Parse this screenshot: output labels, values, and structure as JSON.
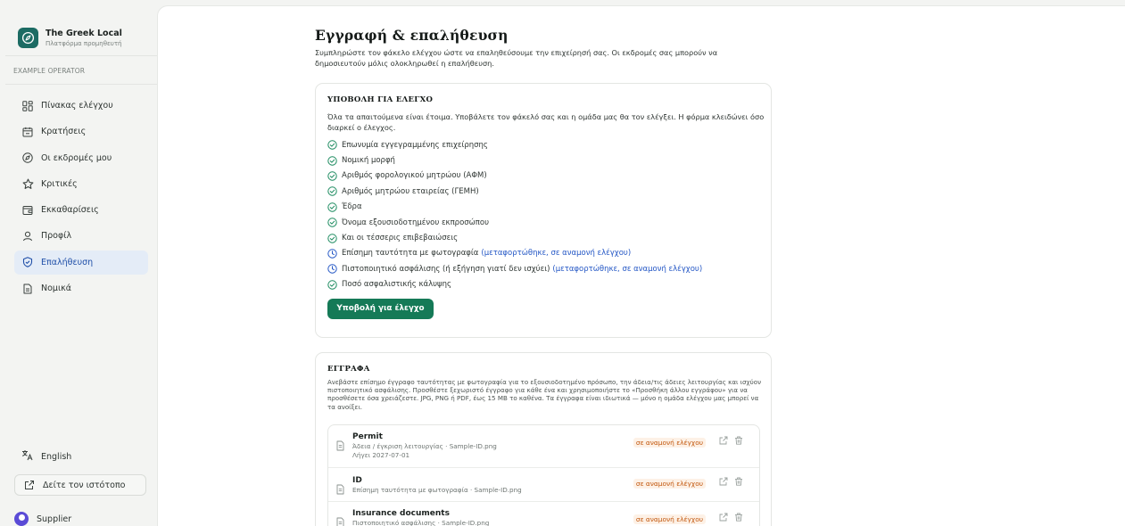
{
  "brand": {
    "name": "The Greek Local",
    "subtitle": "Πλατφόρμα προμηθευτή"
  },
  "operator_label": "EXAMPLE OPERATOR",
  "nav": [
    {
      "label": "Πίνακας ελέγχου",
      "icon": "dashboard-icon",
      "active": false
    },
    {
      "label": "Κρατήσεις",
      "icon": "calendar-icon",
      "active": false
    },
    {
      "label": "Οι εκδρομές μου",
      "icon": "compass-icon",
      "active": false
    },
    {
      "label": "Κριτικές",
      "icon": "star-icon",
      "active": false
    },
    {
      "label": "Εκκαθαρίσεις",
      "icon": "wallet-icon",
      "active": false
    },
    {
      "label": "Προφίλ",
      "icon": "user-icon",
      "active": false
    },
    {
      "label": "Επαλήθευση",
      "icon": "shield-check-icon",
      "active": true
    },
    {
      "label": "Νομικά",
      "icon": "document-icon",
      "active": false
    }
  ],
  "language": {
    "label": "English",
    "icon": "translate-icon"
  },
  "visit_site": {
    "label": "Δείτε τον ιστότοπο",
    "icon": "external-link-icon"
  },
  "user": {
    "name": "Supplier"
  },
  "page": {
    "title": "Εγγραφή & επαλήθευση",
    "description": "Συμπληρώστε τον φάκελο ελέγχου ώστε να επαληθεύσουμε την επιχείρησή σας. Οι εκδρομές σας μπορούν να δημοσιευτούν μόλις ολοκληρωθεί η επαλήθευση."
  },
  "submit_card": {
    "title": "ΥΠΟΒΟΛΗ ΓΙΑ ΕΛΕΓΧΟ",
    "text": "Όλα τα απαιτούμενα είναι έτοιμα. Υποβάλετε τον φάκελό σας και η ομάδα μας θα τον ελέγξει. Η φόρμα κλειδώνει όσο διαρκεί ο έλεγχος.",
    "checklist": [
      {
        "label": "Επωνυμία εγγεγραμμένης επιχείρησης",
        "state": "done",
        "note": ""
      },
      {
        "label": "Νομική μορφή",
        "state": "done",
        "note": ""
      },
      {
        "label": "Αριθμός φορολογικού μητρώου (ΑΦΜ)",
        "state": "done",
        "note": ""
      },
      {
        "label": "Αριθμός μητρώου εταιρείας (ΓΕΜΗ)",
        "state": "done",
        "note": ""
      },
      {
        "label": "Έδρα",
        "state": "done",
        "note": ""
      },
      {
        "label": "Όνομα εξουσιοδοτημένου εκπροσώπου",
        "state": "done",
        "note": ""
      },
      {
        "label": "Και οι τέσσερις επιβεβαιώσεις",
        "state": "done",
        "note": ""
      },
      {
        "label": "Επίσημη ταυτότητα με φωτογραφία",
        "state": "pending",
        "note": "(μεταφορτώθηκε, σε αναμονή ελέγχου)"
      },
      {
        "label": "Πιστοποιητικό ασφάλισης (ή εξήγηση γιατί δεν ισχύει)",
        "state": "pending",
        "note": "(μεταφορτώθηκε, σε αναμονή ελέγχου)"
      },
      {
        "label": "Ποσό ασφαλιστικής κάλυψης",
        "state": "done",
        "note": ""
      }
    ],
    "button": "Υποβολή για έλεγχο"
  },
  "docs_card": {
    "title": "ΕΓΓΡΑΦΑ",
    "text": "Ανεβάστε επίσημο έγγραφο ταυτότητας με φωτογραφία για το εξουσιοδοτημένο πρόσωπο, την άδεια/τις άδειες λειτουργίας και ισχύον πιστοποιητικό ασφάλισης. Προσθέστε ξεχωριστό έγγραφο για κάθε ένα και χρησιμοποιήστε το «Προσθήκη άλλου εγγράφου» για να προσθέσετε όσα χρειάζεστε. JPG, PNG ή PDF, έως 15 MB το καθένα. Τα έγγραφα είναι ιδιωτικά — μόνο η ομάδα ελέγχου μας μπορεί να τα ανοίξει.",
    "documents": [
      {
        "name": "Permit",
        "meta": "Άδεια / έγκριση λειτουργίας · Sample-ID.png",
        "expiry": "Λήγει 2027-07-01",
        "status": "σε αναμονή ελέγχου"
      },
      {
        "name": "ID",
        "meta": "Επίσημη ταυτότητα με φωτογραφία · Sample-ID.png",
        "expiry": "",
        "status": "σε αναμονή ελέγχου"
      },
      {
        "name": "Insurance documents",
        "meta": "Πιστοποιητικό ασφάλισης · Sample-ID.png",
        "expiry": "",
        "status": "σε αναμονή ελέγχου"
      }
    ]
  },
  "colors": {
    "accent": "#157a57",
    "active_nav_bg": "#e4ecf7",
    "link": "#2457c5",
    "pending": "#c2570e",
    "brand": "#1c6b63"
  }
}
